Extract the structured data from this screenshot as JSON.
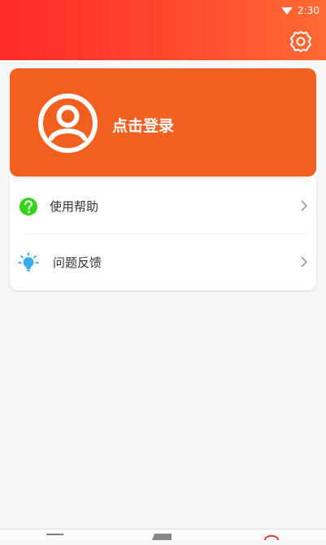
{
  "status_bar": {
    "time": "2:30",
    "wifi_icon": "wifi-icon"
  },
  "header": {
    "settings_icon": "gear-icon",
    "accent_start": "#ff2a2a",
    "accent_end": "#ff6a33"
  },
  "login": {
    "label": "点击登录",
    "avatar_icon": "avatar-icon",
    "card_color": "#f2601f"
  },
  "menu": {
    "items": [
      {
        "label": "使用帮助",
        "icon": "help-icon",
        "icon_color": "#34d41a"
      },
      {
        "label": "问题反馈",
        "icon": "lightbulb-icon",
        "icon_color": "#39a9f0"
      }
    ]
  },
  "navbar": {
    "icons": [
      "home-icon",
      "tag-icon",
      "profile-icon"
    ]
  }
}
